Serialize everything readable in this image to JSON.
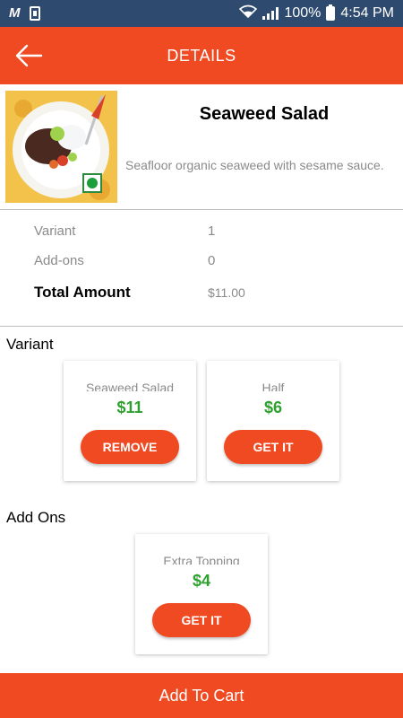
{
  "status_bar": {
    "battery_percent": "100%",
    "time": "4:54 PM",
    "icons": [
      "m-app-icon",
      "sd-card-icon",
      "wifi-icon",
      "signal-icon",
      "battery-icon"
    ]
  },
  "header": {
    "title": "DETAILS",
    "back_icon": "arrow-left-icon",
    "background": "#ef4a22"
  },
  "product": {
    "name": "Seaweed Salad",
    "description": "Seafloor organic seaweed with sesame sauce.",
    "veg_icon": "veg-indicator-icon"
  },
  "summary": {
    "variant_label": "Variant",
    "variant_value": "1",
    "addons_label": "Add-ons",
    "addons_value": "0",
    "total_label": "Total Amount",
    "total_value": "$11.00"
  },
  "variant_section": {
    "title": "Variant",
    "cards": [
      {
        "name": "Seaweed Salad",
        "price": "$11",
        "button": "REMOVE"
      },
      {
        "name": "Half",
        "price": "$6",
        "button": "GET IT"
      }
    ]
  },
  "addons_section": {
    "title": "Add Ons",
    "cards": [
      {
        "name": "Extra Topping",
        "price": "$4",
        "button": "GET IT"
      }
    ]
  },
  "footer": {
    "cart_label": "Add To Cart"
  },
  "colors": {
    "accent": "#ef4a22",
    "price": "#2ea02e",
    "status_bar": "#2e4a6e"
  }
}
